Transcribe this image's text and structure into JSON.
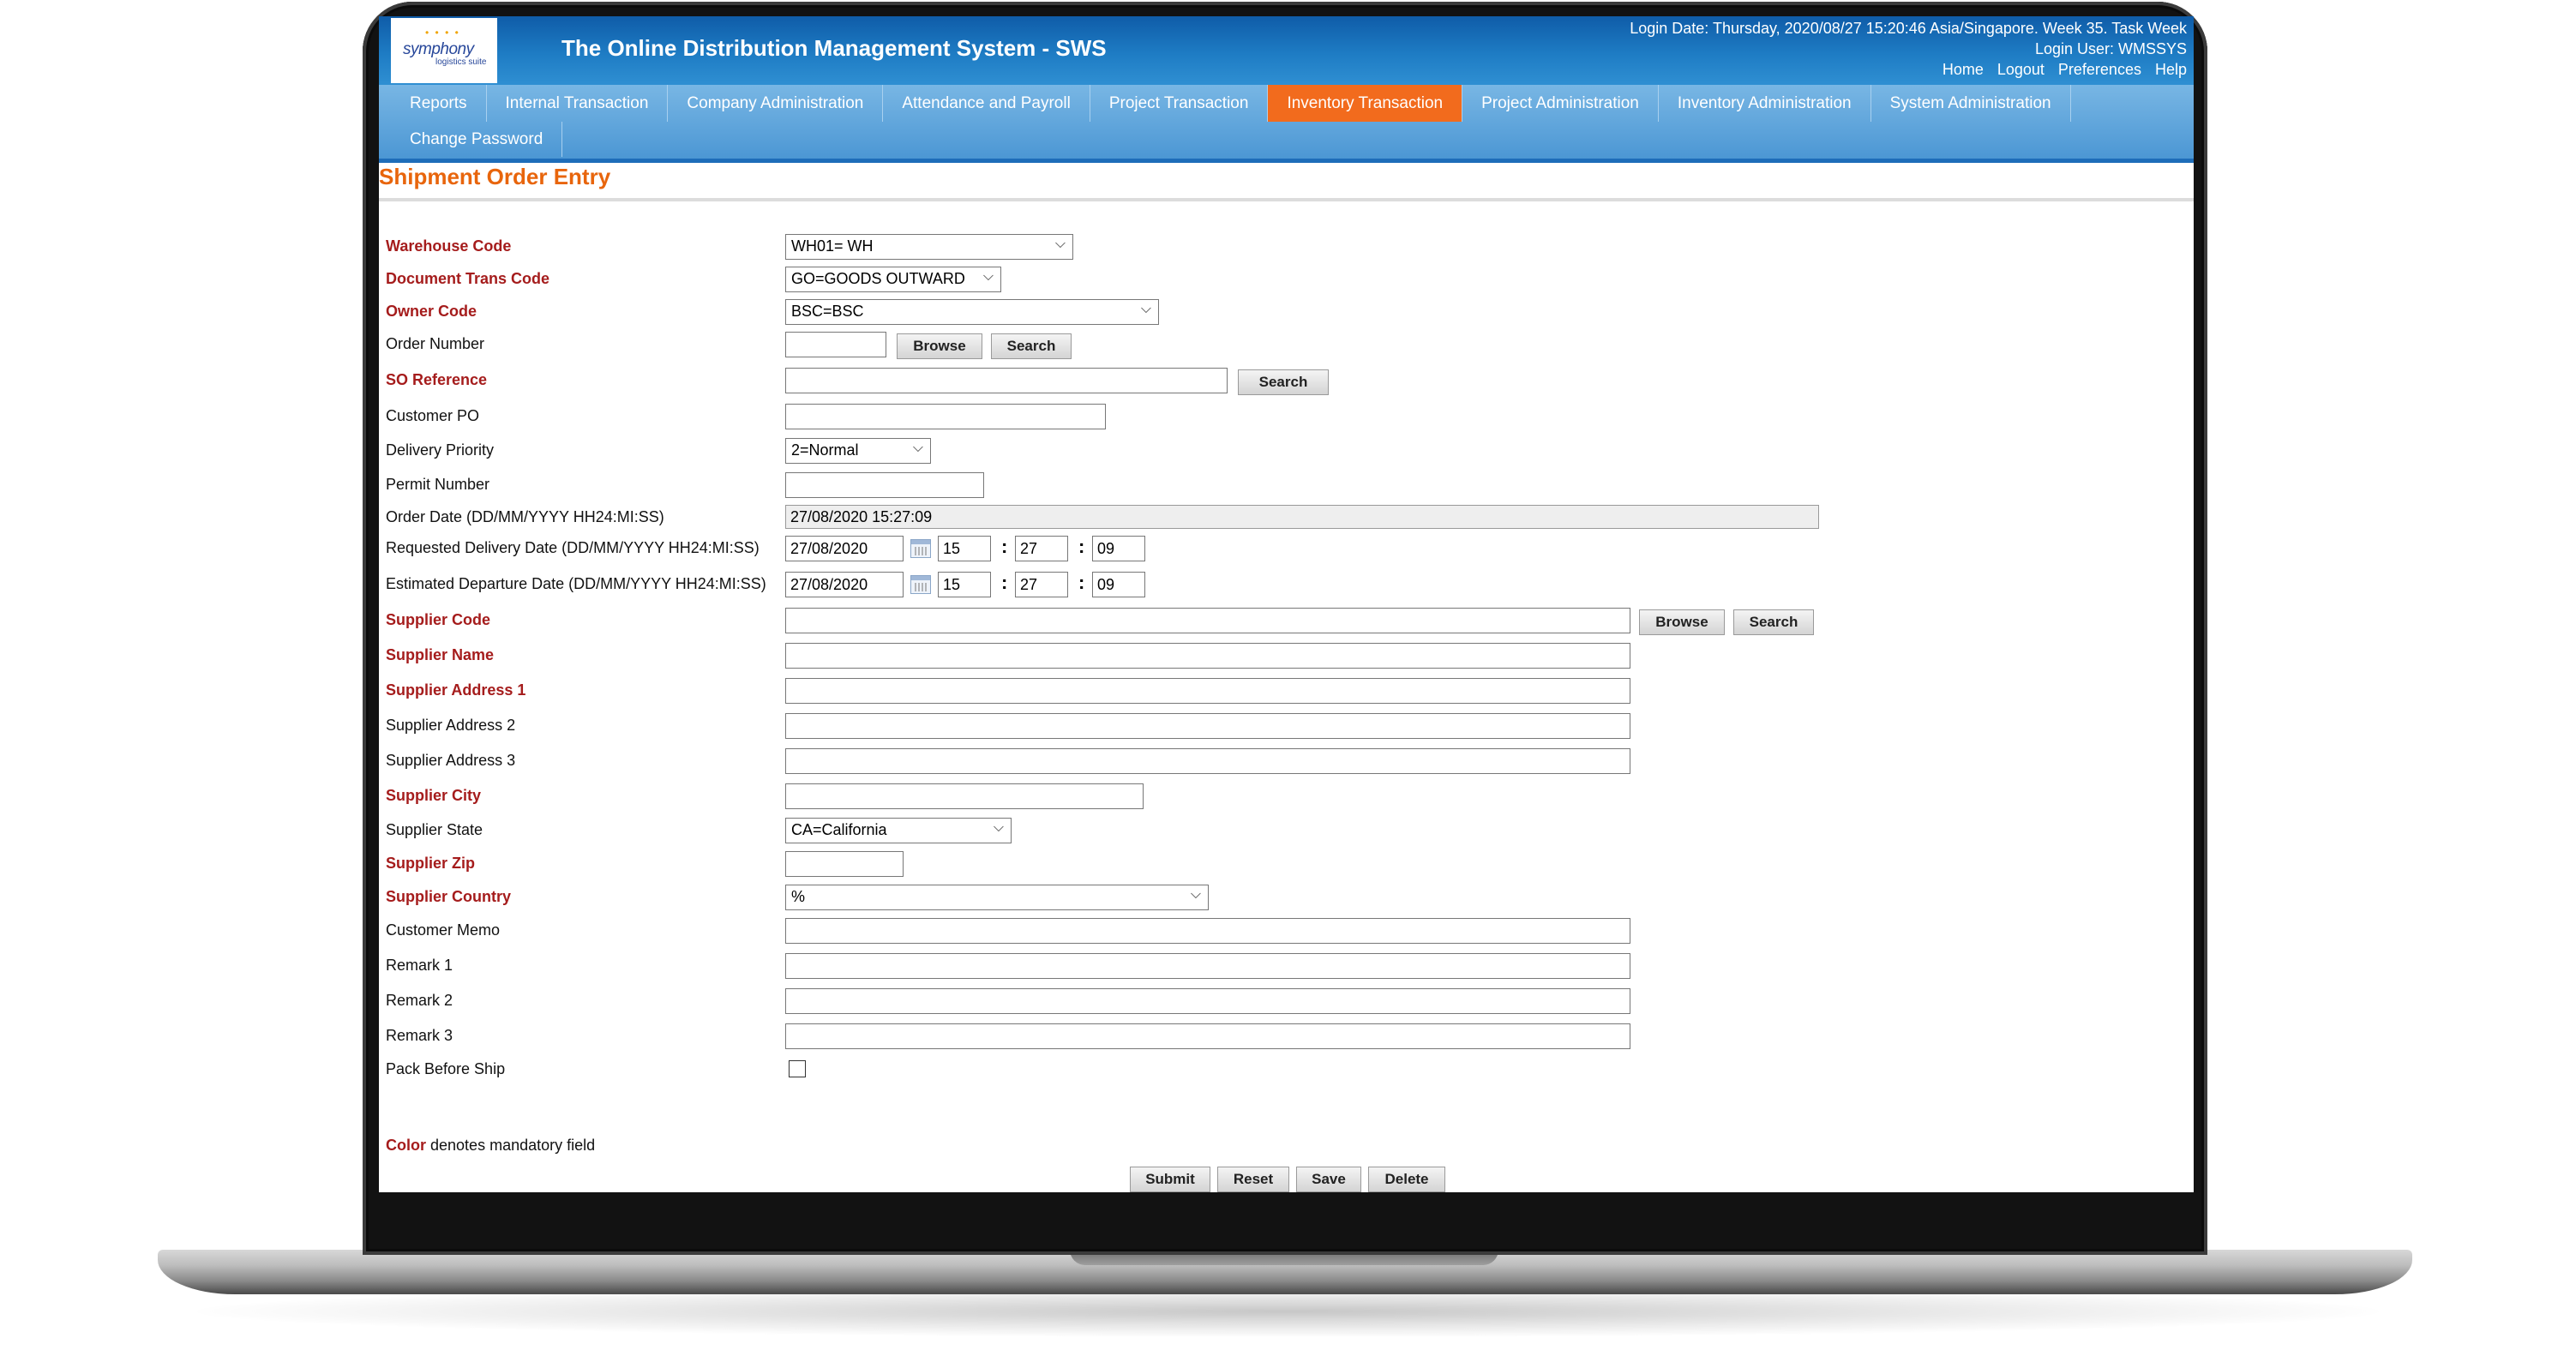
{
  "header": {
    "logo_name": "symphony",
    "logo_sub": "logistics suite",
    "app_title": "The Online Distribution Management System - SWS",
    "login_date": "Login Date: Thursday, 2020/08/27 15:20:46 Asia/Singapore. Week 35. Task Week",
    "login_user": "Login User: WMSSYS",
    "links": {
      "home": "Home",
      "logout": "Logout",
      "preferences": "Preferences",
      "help": "Help"
    }
  },
  "nav": {
    "row1": [
      "Reports",
      "Internal Transaction",
      "Company Administration",
      "Attendance and Payroll",
      "Project Transaction",
      "Inventory Transaction",
      "Project Administration",
      "Inventory Administration",
      "System Administration"
    ],
    "row2": [
      "Change Password"
    ],
    "active": "Inventory Transaction",
    "active_color": "#f26b1d"
  },
  "page": {
    "title": "Shipment Order Entry"
  },
  "form": {
    "warehouse_code": {
      "label": "Warehouse Code",
      "value": "WH01= WH"
    },
    "document_trans_code": {
      "label": "Document Trans Code",
      "value": "GO=GOODS OUTWARD"
    },
    "owner_code": {
      "label": "Owner Code",
      "value": "BSC=BSC"
    },
    "order_number": {
      "label": "Order Number",
      "value": "",
      "browse": "Browse",
      "search": "Search"
    },
    "so_reference": {
      "label": "SO Reference",
      "value": "",
      "search": "Search"
    },
    "customer_po": {
      "label": "Customer PO",
      "value": ""
    },
    "delivery_priority": {
      "label": "Delivery Priority",
      "value": "2=Normal"
    },
    "permit_number": {
      "label": "Permit Number",
      "value": ""
    },
    "order_date": {
      "label": "Order Date (DD/MM/YYYY HH24:MI:SS)",
      "value": "27/08/2020 15:27:09"
    },
    "requested_delivery_date": {
      "label": "Requested Delivery Date (DD/MM/YYYY HH24:MI:SS)",
      "date": "27/08/2020",
      "hh": "15",
      "mi": "27",
      "ss": "09"
    },
    "estimated_departure_date": {
      "label": "Estimated Departure Date (DD/MM/YYYY HH24:MI:SS)",
      "date": "27/08/2020",
      "hh": "15",
      "mi": "27",
      "ss": "09"
    },
    "time_separator": ":",
    "supplier_code": {
      "label": "Supplier Code",
      "value": "",
      "browse": "Browse",
      "search": "Search"
    },
    "supplier_name": {
      "label": "Supplier Name",
      "value": ""
    },
    "supplier_address_1": {
      "label": "Supplier Address 1",
      "value": ""
    },
    "supplier_address_2": {
      "label": "Supplier Address 2",
      "value": ""
    },
    "supplier_address_3": {
      "label": "Supplier Address 3",
      "value": ""
    },
    "supplier_city": {
      "label": "Supplier City",
      "value": ""
    },
    "supplier_state": {
      "label": "Supplier State",
      "value": "CA=California"
    },
    "supplier_zip": {
      "label": "Supplier Zip",
      "value": ""
    },
    "supplier_country": {
      "label": "Supplier Country",
      "value": "%"
    },
    "customer_memo": {
      "label": "Customer Memo",
      "value": ""
    },
    "remark_1": {
      "label": "Remark 1",
      "value": ""
    },
    "remark_2": {
      "label": "Remark 2",
      "value": ""
    },
    "remark_3": {
      "label": "Remark 3",
      "value": ""
    },
    "pack_before_ship": {
      "label": "Pack Before Ship",
      "checked": false
    }
  },
  "legend": {
    "color_word": "Color",
    "text": "denotes mandatory field"
  },
  "actions": {
    "submit": "Submit",
    "reset": "Reset",
    "save": "Save",
    "delete": "Delete"
  },
  "colors": {
    "mandatory_label": "#a51c1c",
    "title": "#e8650c",
    "header_blue": "#1e7cc4"
  }
}
